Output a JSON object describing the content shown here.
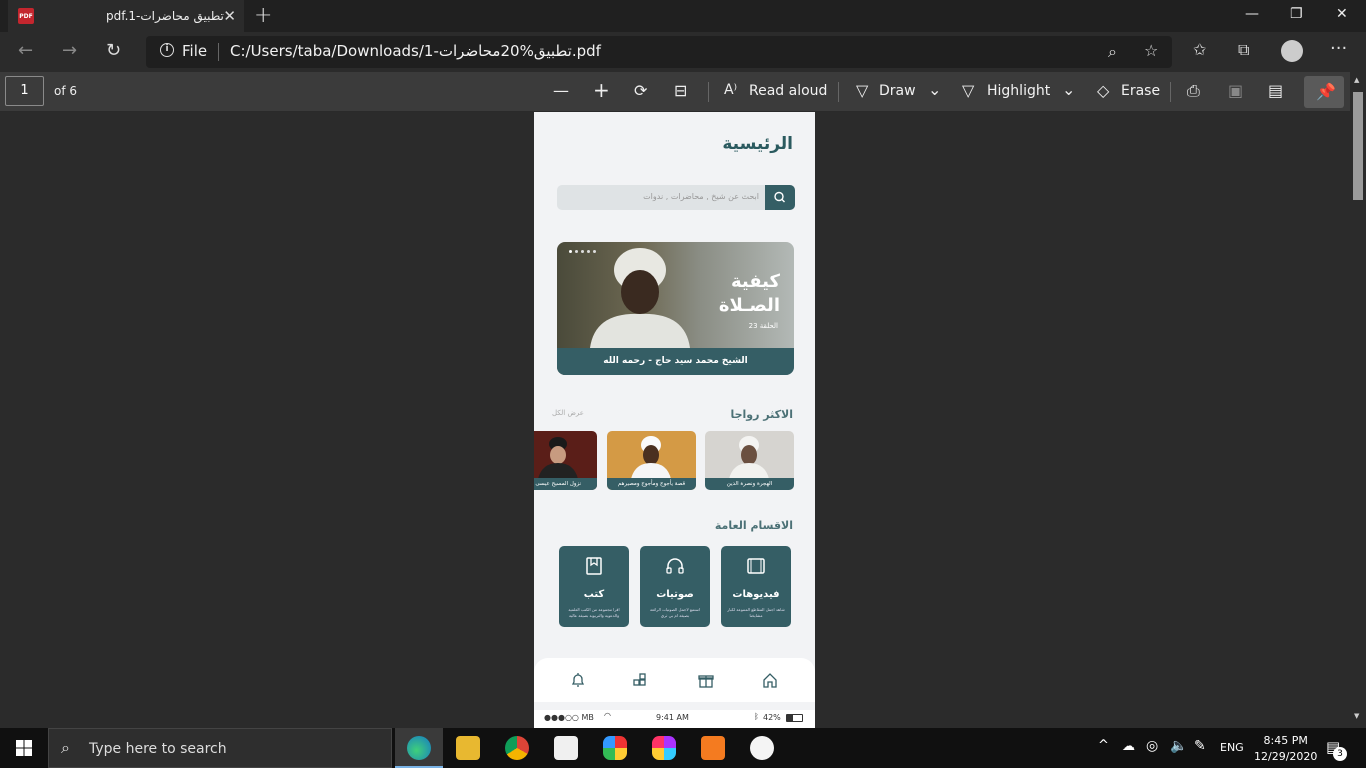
{
  "browser": {
    "tab_title": "pdf.1-تطبيق محاضرات",
    "file_label": "File",
    "url": "C:/Users/taba/Downloads/1-تطبيق%20محاضرات.pdf",
    "new_tab_symbol": "+"
  },
  "pdf_toolbar": {
    "page_number": "1",
    "page_of": "of 6",
    "read_aloud": "Read aloud",
    "draw": "Draw",
    "highlight": "Highlight",
    "erase": "Erase"
  },
  "doc": {
    "title": "الرئيسية",
    "search_placeholder": "ابحث عن شيخ , محاضرات , ندوات",
    "banner": {
      "heading_line1": "كيفية",
      "heading_line2": "الصـلاة",
      "episode": "الحلقة 23",
      "caption": "الشيخ محمد سيد حاج - رحمه الله"
    },
    "trending": {
      "title": "الاكثر رواجا",
      "see_all": "عرض الكل",
      "cards": [
        {
          "caption": "الهجرة ونصرة الدين"
        },
        {
          "caption": "قصة يأجوج ومأجوج ومصيرهم"
        },
        {
          "caption": "نزول المسيح عيسى عليه"
        }
      ]
    },
    "sections": {
      "title": "الاقسام العامة",
      "items": [
        {
          "title": "فيديوهات",
          "desc": "شاهد اجمل المقاطع المتنوعة لكبار مشايخنا"
        },
        {
          "title": "صوتيات",
          "desc": "استمع لاجمل الصوتيات الرائعة بصيغة ام بي ثري"
        },
        {
          "title": "كتب",
          "desc": "اقرا مجموعة من الكتب العلمية والدعوية والتربوية بصيغة عالية"
        }
      ]
    },
    "status": {
      "carrier": "●●●○○ MB",
      "time": "9:41 AM",
      "battery": "42%"
    }
  },
  "taskbar": {
    "search_placeholder": "Type here to search",
    "lang": "ENG",
    "time": "8:45 PM",
    "date": "12/29/2020",
    "notif_count": "3"
  },
  "colors": {
    "accent_teal": "#355e65",
    "app_bg": "#f2f3f5",
    "viewer_bg": "#2b2b2b"
  }
}
